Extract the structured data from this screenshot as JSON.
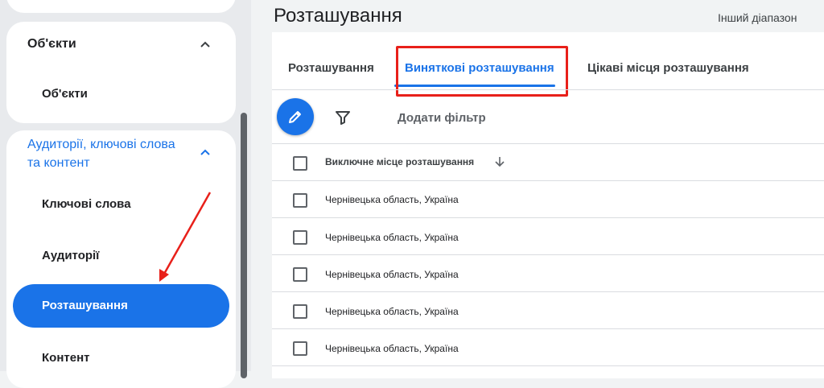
{
  "sidebar": {
    "objects_section": {
      "title": "Об'єкти",
      "items": [
        {
          "label": "Об'єкти"
        }
      ]
    },
    "audience_section": {
      "title_line1": "Аудиторії, ключові слова",
      "title_line2": "та контент",
      "items": [
        {
          "label": "Ключові слова"
        },
        {
          "label": "Аудиторії"
        },
        {
          "label": "Розташування",
          "active": true
        },
        {
          "label": "Контент"
        }
      ]
    }
  },
  "main": {
    "title": "Розташування",
    "date_range_label": "Інший діапазон",
    "tabs": [
      {
        "label": "Розташування",
        "active": false
      },
      {
        "label": "Виняткові розташування",
        "active": true
      },
      {
        "label": "Цікаві місця розташування",
        "active": false
      }
    ],
    "toolbar": {
      "add_filter_label": "Додати фільтр"
    },
    "table": {
      "column_header": "Виключне місце розташування",
      "rows": [
        {
          "location": "Чернівецька область, Україна"
        },
        {
          "location": "Чернівецька область, Україна"
        },
        {
          "location": "Чернівецька область, Україна"
        },
        {
          "location": "Чернівецька область, Україна"
        },
        {
          "location": "Чернівецька область, Україна"
        }
      ]
    }
  },
  "icons": {
    "fab": "pencil-icon",
    "filter": "filter-icon",
    "sort": "arrow-down-icon",
    "collapse": "chevron-up-icon"
  },
  "colors": {
    "accent": "#1a73e8",
    "annotation_red": "#e8201a",
    "sidebar_bg": "#e8eaed",
    "divider": "#dadce0"
  }
}
